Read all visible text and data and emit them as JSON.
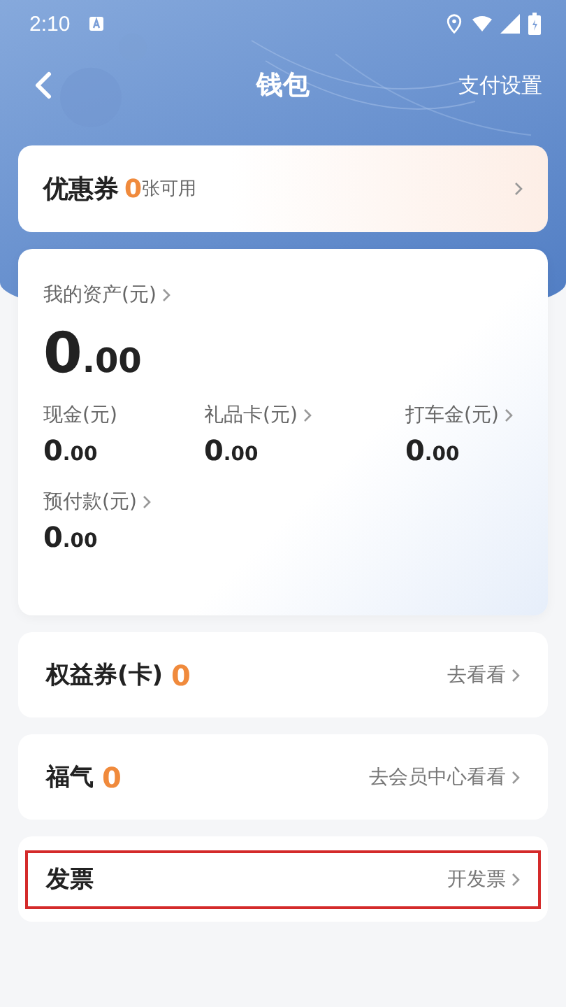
{
  "status_bar": {
    "time": "2:10"
  },
  "header": {
    "title": "钱包",
    "action": "支付设置"
  },
  "coupon": {
    "label": "优惠券",
    "count": "0",
    "suffix": "张可用"
  },
  "assets": {
    "label": "我的资产(元)",
    "whole": "0",
    "fraction": ".00",
    "items": [
      {
        "label": "现金(元)",
        "whole": "0",
        "fraction": ".00",
        "arrow": false
      },
      {
        "label": "礼品卡(元)",
        "whole": "0",
        "fraction": ".00",
        "arrow": true
      },
      {
        "label": "打车金(元)",
        "whole": "0",
        "fraction": ".00",
        "arrow": true
      },
      {
        "label": "预付款(元)",
        "whole": "0",
        "fraction": ".00",
        "arrow": true
      }
    ]
  },
  "rows": [
    {
      "label": "权益券(卡)",
      "count": "0",
      "action": "去看看",
      "highlighted": false
    },
    {
      "label": "福气",
      "count": "0",
      "action": "去会员中心看看",
      "highlighted": false
    },
    {
      "label": "发票",
      "action": "开发票",
      "highlighted": true
    }
  ]
}
